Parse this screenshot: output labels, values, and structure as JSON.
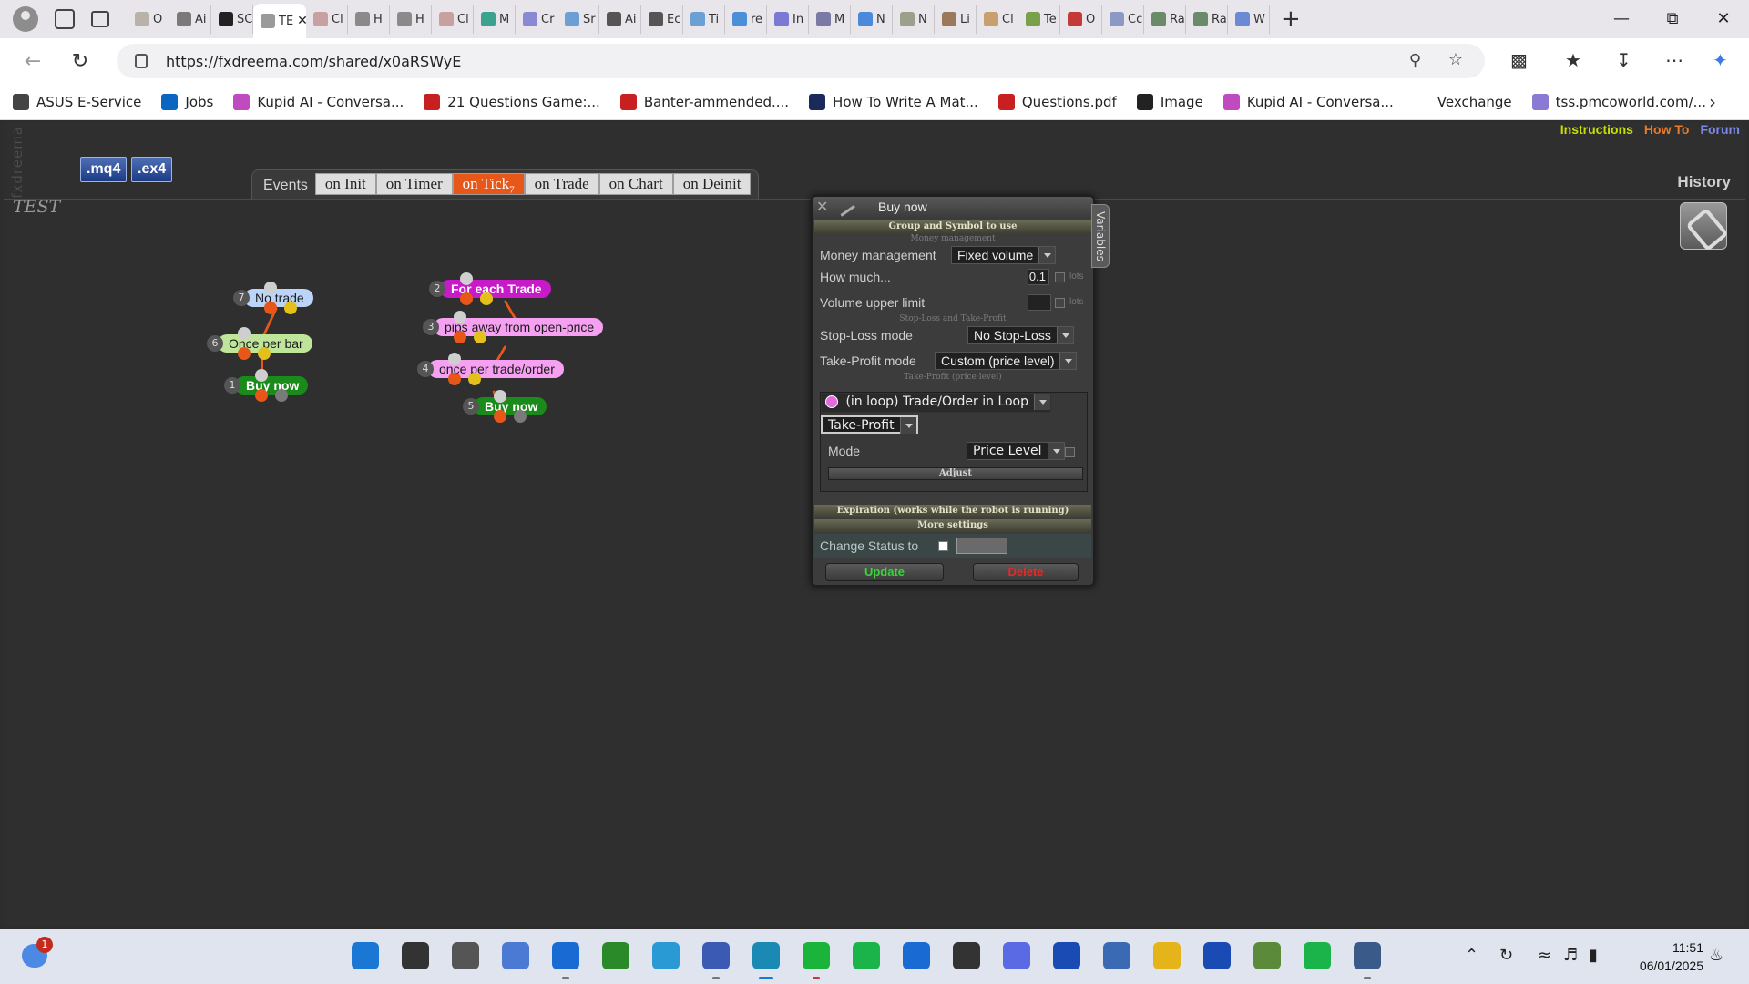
{
  "browser": {
    "tabs": [
      {
        "label": "O",
        "color": "#b8b2a8"
      },
      {
        "label": "Ai",
        "color": "#7a7a7a"
      },
      {
        "label": "SC",
        "color": "#222222"
      },
      {
        "label": "TE",
        "color": "#9a9a9a",
        "active": true
      },
      {
        "label": "Cl",
        "color": "#c9a0a0"
      },
      {
        "label": "H",
        "color": "#8a8a8a"
      },
      {
        "label": "H",
        "color": "#8a8a8a"
      },
      {
        "label": "Cl",
        "color": "#c9a0a0"
      },
      {
        "label": "M",
        "color": "#3aa38f"
      },
      {
        "label": "Cr",
        "color": "#8a8ad4"
      },
      {
        "label": "Sr",
        "color": "#6ba0d4"
      },
      {
        "label": "Ai",
        "color": "#555555"
      },
      {
        "label": "Ec",
        "color": "#555555"
      },
      {
        "label": "Ti",
        "color": "#6ba0d4"
      },
      {
        "label": "re",
        "color": "#4a90d9"
      },
      {
        "label": "In",
        "color": "#7a7ad4"
      },
      {
        "label": "M",
        "color": "#7a7aa4"
      },
      {
        "label": "N",
        "color": "#4a8ad9"
      },
      {
        "label": "N",
        "color": "#9aa08a"
      },
      {
        "label": "Li",
        "color": "#9a7a5a"
      },
      {
        "label": "Cl",
        "color": "#c8a070"
      },
      {
        "label": "Te",
        "color": "#7aa04a"
      },
      {
        "label": "O",
        "color": "#c43a3a"
      },
      {
        "label": "Cc",
        "color": "#8a9ac4"
      },
      {
        "label": "Ra",
        "color": "#6a8a6a"
      },
      {
        "label": "Ra",
        "color": "#6a8a6a"
      },
      {
        "label": "W",
        "color": "#6a8ad4"
      }
    ],
    "url": "https://fxdreema.com/shared/x0aRSWyE",
    "bookmarks": [
      {
        "label": "ASUS E-Service",
        "color": "#444444"
      },
      {
        "label": "Jobs",
        "color": "#0a66c2"
      },
      {
        "label": "Kupid AI - Conversa...",
        "color": "#c04ac0"
      },
      {
        "label": "21 Questions Game:...",
        "color": "#c82020"
      },
      {
        "label": "Banter-ammended....",
        "color": "#c82020"
      },
      {
        "label": "How To Write A Mat...",
        "color": "#1a2a5a"
      },
      {
        "label": "Questions.pdf",
        "color": "#c82020"
      },
      {
        "label": "Image",
        "color": "#222222"
      },
      {
        "label": "Kupid AI - Conversa...",
        "color": "#c04ac0"
      },
      {
        "label": "Vexchange",
        "color": "#ffffff"
      },
      {
        "label": "tss.pmcoworld.com/...",
        "color": "#8a7ad4"
      }
    ]
  },
  "app": {
    "brand": "fxdreema",
    "download_buttons": [
      ".mq4",
      ".ex4"
    ],
    "project_title": "TEST",
    "top_links": [
      {
        "label": "Instructions",
        "color": "#c8e000"
      },
      {
        "label": "How To",
        "color": "#e87a2a"
      },
      {
        "label": "Forum",
        "color": "#7a8ae8"
      }
    ],
    "history_label": "History",
    "events_label": "Events",
    "event_tabs": [
      {
        "label": "on Init"
      },
      {
        "label": "on Timer"
      },
      {
        "label": "on Tick",
        "count": "7",
        "active": true
      },
      {
        "label": "on Trade"
      },
      {
        "label": "on Chart"
      },
      {
        "label": "on Deinit"
      }
    ],
    "blocks": [
      {
        "id": "7",
        "label": "No trade",
        "bg": "#bcd4f8",
        "fg": "#1a1a1a"
      },
      {
        "id": "6",
        "label": "Once per bar",
        "bg": "#bfe59a",
        "fg": "#1a1a1a"
      },
      {
        "id": "1",
        "label": "Buy now",
        "bg": "#1a8a1a",
        "fg": "#ffffff"
      },
      {
        "id": "2",
        "label": "For each Trade",
        "bg": "#c81ac8",
        "fg": "#ffffff"
      },
      {
        "id": "3",
        "label": "pips away from open-price",
        "bg": "#f5a0f0",
        "fg": "#1a1a1a"
      },
      {
        "id": "4",
        "label": "once per trade/order",
        "bg": "#f5a0f0",
        "fg": "#1a1a1a"
      },
      {
        "id": "5",
        "label": "Buy now",
        "bg": "#1a8a1a",
        "fg": "#ffffff"
      }
    ],
    "panel": {
      "title": "Buy now",
      "variables_tab": "Variables",
      "sections": {
        "group_symbol": "Group and Symbol to use",
        "money_management": "Money management",
        "sl_tp": "Stop-Loss and Take-Profit",
        "tp_price_level": "Take-Profit (price level)",
        "expiration": "Expiration (works while the robot is running)",
        "more_settings": "More settings"
      },
      "money_management_label": "Money management",
      "money_management_value": "Fixed volume",
      "how_much_label": "How much...",
      "how_much_value": "0.1",
      "lots_unit": "lots",
      "volume_upper_limit_label": "Volume upper limit",
      "volume_upper_limit_value": "",
      "stop_loss_mode_label": "Stop-Loss mode",
      "stop_loss_mode_value": "No Stop-Loss",
      "take_profit_mode_label": "Take-Profit mode",
      "take_profit_mode_value": "Custom (price level)",
      "loop_source_value": "(in loop) Trade/Order in Loop",
      "loop_field_value": "Take-Profit",
      "mode_label": "Mode",
      "mode_value": "Price Level",
      "adjust_label": "Adjust",
      "change_status_label": "Change Status to",
      "update_label": "Update",
      "delete_label": "Delete"
    }
  },
  "taskbar": {
    "notification_count": "1",
    "time": "11:51",
    "date": "06/01/2025",
    "apps": [
      {
        "name": "start",
        "color": "#1a78d4"
      },
      {
        "name": "search",
        "color": "#333333"
      },
      {
        "name": "task-view",
        "color": "#555555"
      },
      {
        "name": "copilot",
        "color": "#4a7ad4"
      },
      {
        "name": "outlook",
        "color": "#1a6ad4"
      },
      {
        "name": "nvidia",
        "color": "#2a8a2a"
      },
      {
        "name": "telegram",
        "color": "#2a9ad4"
      },
      {
        "name": "remote-desktop",
        "color": "#3a5ab4"
      },
      {
        "name": "edge",
        "color": "#1a8ab4"
      },
      {
        "name": "whatsapp",
        "color": "#1ab43a"
      },
      {
        "name": "spotify",
        "color": "#1ab44a"
      },
      {
        "name": "vscode",
        "color": "#1a6ad4"
      },
      {
        "name": "media-player",
        "color": "#333333"
      },
      {
        "name": "discord",
        "color": "#5a6ae4"
      },
      {
        "name": "paypal",
        "color": "#1a4ab4"
      },
      {
        "name": "snip",
        "color": "#3a6ab4"
      },
      {
        "name": "file-explorer",
        "color": "#e4b41a"
      },
      {
        "name": "paypal-2",
        "color": "#1a4ab4"
      },
      {
        "name": "metatrader",
        "color": "#5a8a3a"
      },
      {
        "name": "spotify-2",
        "color": "#1ab44a"
      },
      {
        "name": "speedometer",
        "color": "#3a5a8a"
      }
    ]
  }
}
